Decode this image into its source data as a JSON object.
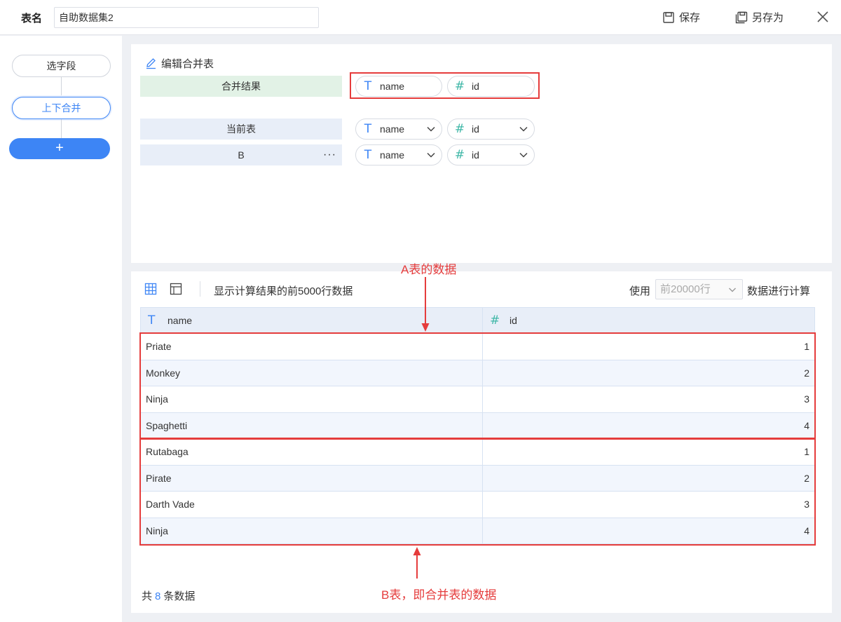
{
  "header": {
    "table_name_label": "表名",
    "table_name_value": "自助数据集2",
    "save_label": "保存",
    "save_as_label": "另存为"
  },
  "steps": {
    "select_fields": "选字段",
    "union": "上下合并",
    "add": "+"
  },
  "union_panel": {
    "edit_title": "编辑合并表",
    "result_label": "合并结果",
    "current_label": "当前表",
    "b_label": "B",
    "more": "···",
    "result_fields": [
      {
        "icon": "T",
        "name": "name"
      },
      {
        "icon": "#",
        "name": "id"
      }
    ],
    "current_fields": [
      {
        "icon": "T",
        "name": "name"
      },
      {
        "icon": "#",
        "name": "id"
      }
    ],
    "b_fields": [
      {
        "icon": "T",
        "name": "name"
      },
      {
        "icon": "#",
        "name": "id"
      }
    ]
  },
  "preview": {
    "desc": "显示计算结果的前5000行数据",
    "use_label": "使用",
    "use_value": "前20000行",
    "use_end": "数据进行计算",
    "columns": [
      {
        "icon": "T",
        "name": "name"
      },
      {
        "icon": "#",
        "name": "id"
      }
    ],
    "rows": [
      [
        "Priate",
        "1"
      ],
      [
        "Monkey",
        "2"
      ],
      [
        "Ninja",
        "3"
      ],
      [
        "Spaghetti",
        "4"
      ],
      [
        "Rutabaga",
        "1"
      ],
      [
        "Pirate",
        "2"
      ],
      [
        "Darth Vade",
        "3"
      ],
      [
        "Ninja",
        "4"
      ]
    ],
    "total_prefix": "共",
    "total_count": "8",
    "total_suffix": "条数据"
  },
  "annotations": {
    "a_table": "A表的数据",
    "b_table": "B表，即合并表的数据"
  },
  "colors": {
    "accent": "#3d85f5",
    "annotation_red": "#e53c3c",
    "number_icon": "#3fb7a7"
  }
}
